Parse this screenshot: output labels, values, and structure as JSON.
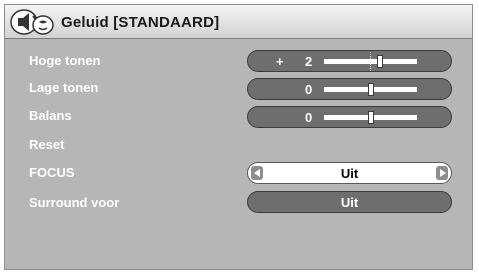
{
  "title": "Geluid [STANDAARD]",
  "title_icon": "speaker-sound-icon",
  "rows": [
    {
      "label": "Hoge tonen",
      "sign": "+",
      "value": "2",
      "level": 2,
      "range": [
        -10,
        10
      ]
    },
    {
      "label": "Lage tonen",
      "sign": "",
      "value": "0",
      "level": 0,
      "range": [
        -10,
        10
      ]
    },
    {
      "label": "Balans",
      "sign": "",
      "value": "0",
      "level": 0,
      "range": [
        -10,
        10
      ]
    },
    {
      "label": "Reset"
    },
    {
      "label": "FOCUS",
      "value": "Uit",
      "left_icon": "left-arrow-icon",
      "right_icon": "right-arrow-icon"
    },
    {
      "label": "Surround voor",
      "value": "Uit"
    }
  ],
  "colors": {
    "panel": "#b6b6b6",
    "pill": "#6e6e6e",
    "selected": "#ffffff",
    "text": "#ffffff"
  }
}
